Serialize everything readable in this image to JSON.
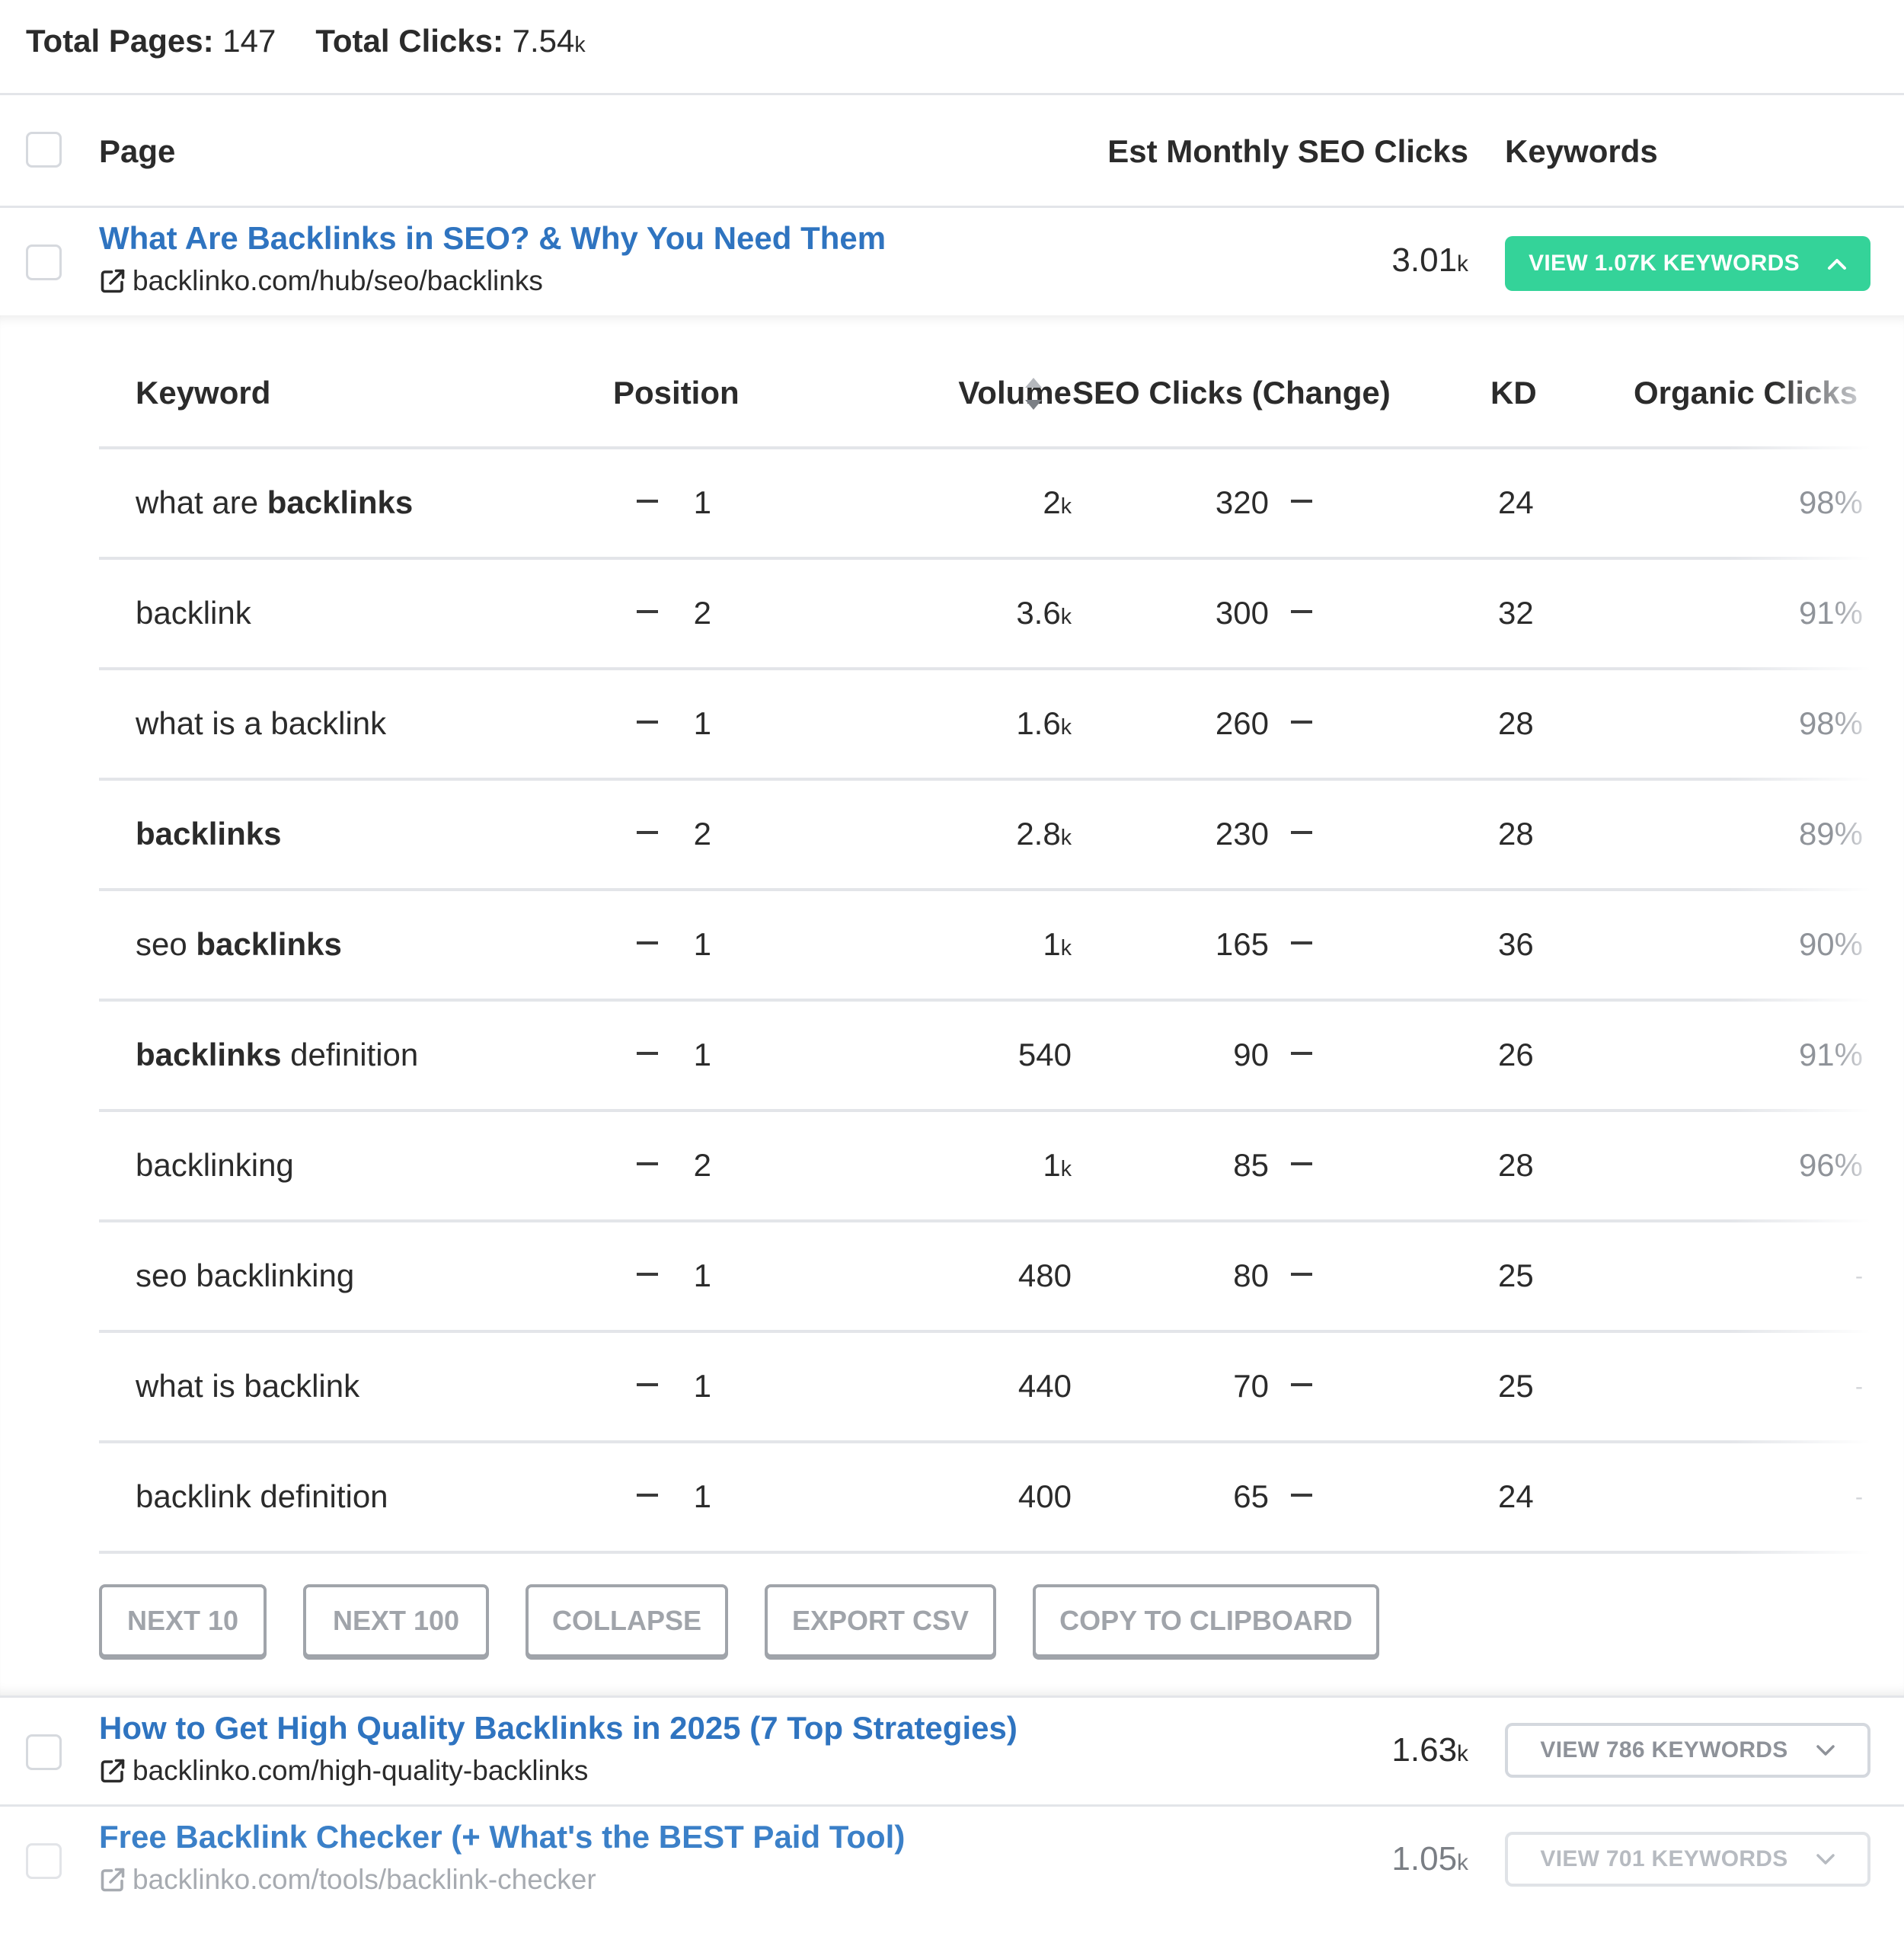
{
  "summary": {
    "total_pages_label": "Total Pages:",
    "total_pages_value": "147",
    "total_clicks_label": "Total Clicks:",
    "total_clicks_value": "7.54",
    "total_clicks_suffix": "k"
  },
  "main_table": {
    "headers": {
      "page": "Page",
      "est_clicks": "Est Monthly SEO Clicks",
      "keywords": "Keywords"
    },
    "rows": [
      {
        "title": "What Are Backlinks in SEO? & Why You Need Them",
        "url": "backlinko.com/hub/seo/backlinks",
        "clicks_value": "3.01",
        "clicks_suffix": "k",
        "keywords_button": "VIEW 1.07K KEYWORDS",
        "expanded": true
      },
      {
        "title": "How to Get High Quality Backlinks in 2025 (7 Top Strategies)",
        "url": "backlinko.com/high-quality-backlinks",
        "clicks_value": "1.63",
        "clicks_suffix": "k",
        "keywords_button": "VIEW 786 KEYWORDS",
        "expanded": false
      },
      {
        "title": "Free Backlink Checker (+ What's the BEST Paid Tool)",
        "url": "backlinko.com/tools/backlink-checker",
        "clicks_value": "1.05",
        "clicks_suffix": "k",
        "keywords_button": "VIEW 701 KEYWORDS",
        "expanded": false
      }
    ]
  },
  "keyword_table": {
    "headers": {
      "keyword": "Keyword",
      "position": "Position",
      "volume": "Volume",
      "seo_clicks": "SEO Clicks (Change)",
      "kd": "KD",
      "organic_clicks": "Organic Clicks"
    },
    "sort_icon": "sort-up-down-icon",
    "change_symbol": "–",
    "rows": [
      {
        "keyword_parts": [
          {
            "t": "what are ",
            "b": false
          },
          {
            "t": "backlinks",
            "b": true
          }
        ],
        "position": "1",
        "volume": "2",
        "volume_suffix": "k",
        "seo_clicks": "320",
        "kd": "24",
        "organic": "98%"
      },
      {
        "keyword_parts": [
          {
            "t": "backlink",
            "b": false
          }
        ],
        "position": "2",
        "volume": "3.6",
        "volume_suffix": "k",
        "seo_clicks": "300",
        "kd": "32",
        "organic": "91%"
      },
      {
        "keyword_parts": [
          {
            "t": "what is a backlink",
            "b": false
          }
        ],
        "position": "1",
        "volume": "1.6",
        "volume_suffix": "k",
        "seo_clicks": "260",
        "kd": "28",
        "organic": "98%"
      },
      {
        "keyword_parts": [
          {
            "t": "backlinks",
            "b": true
          }
        ],
        "position": "2",
        "volume": "2.8",
        "volume_suffix": "k",
        "seo_clicks": "230",
        "kd": "28",
        "organic": "89%"
      },
      {
        "keyword_parts": [
          {
            "t": "seo ",
            "b": false
          },
          {
            "t": "backlinks",
            "b": true
          }
        ],
        "position": "1",
        "volume": "1",
        "volume_suffix": "k",
        "seo_clicks": "165",
        "kd": "36",
        "organic": "90%"
      },
      {
        "keyword_parts": [
          {
            "t": "backlinks",
            "b": true
          },
          {
            "t": " definition",
            "b": false
          }
        ],
        "position": "1",
        "volume": "540",
        "volume_suffix": "",
        "seo_clicks": "90",
        "kd": "26",
        "organic": "91%"
      },
      {
        "keyword_parts": [
          {
            "t": "backlinking",
            "b": false
          }
        ],
        "position": "2",
        "volume": "1",
        "volume_suffix": "k",
        "seo_clicks": "85",
        "kd": "28",
        "organic": "96%"
      },
      {
        "keyword_parts": [
          {
            "t": "seo backlinking",
            "b": false
          }
        ],
        "position": "1",
        "volume": "480",
        "volume_suffix": "",
        "seo_clicks": "80",
        "kd": "25",
        "organic": "-"
      },
      {
        "keyword_parts": [
          {
            "t": "what is backlink",
            "b": false
          }
        ],
        "position": "1",
        "volume": "440",
        "volume_suffix": "",
        "seo_clicks": "70",
        "kd": "25",
        "organic": "-"
      },
      {
        "keyword_parts": [
          {
            "t": "backlink definition",
            "b": false
          }
        ],
        "position": "1",
        "volume": "400",
        "volume_suffix": "",
        "seo_clicks": "65",
        "kd": "24",
        "organic": "-"
      }
    ],
    "actions": [
      "NEXT 10",
      "NEXT 100",
      "COLLAPSE",
      "EXPORT CSV",
      "COPY TO CLIPBOARD"
    ]
  },
  "colors": {
    "accent_green": "#34d399",
    "link_blue": "#2f74c0",
    "muted_gray": "#a0a4aa"
  }
}
